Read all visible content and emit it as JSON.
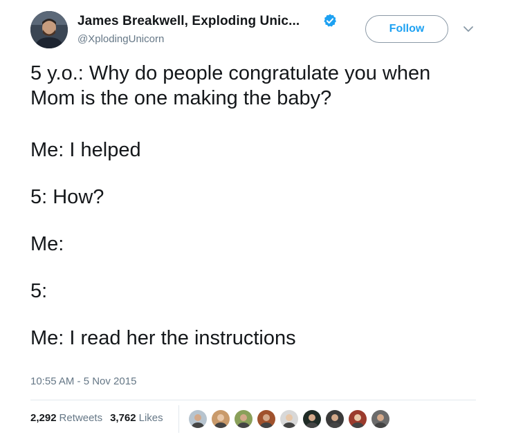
{
  "author": {
    "display_name": "James Breakwell, Exploding Unic...",
    "handle": "@XplodingUnicorn",
    "verified": true
  },
  "follow_button": {
    "label": "Follow"
  },
  "tweet": {
    "paragraphs": [
      "5 y.o.: Why do people congratulate you when\nMom is the one making the baby?",
      "Me: I helped",
      "5: How?",
      "Me:",
      "5:",
      "Me: I read her the instructions"
    ],
    "timestamp": "10:55 AM - 5 Nov 2015"
  },
  "stats": {
    "retweets_count": "2,292",
    "retweets_label": "Retweets",
    "likes_count": "3,762",
    "likes_label": "Likes"
  },
  "likers": [
    {
      "name": "liker-avatar-1",
      "color": "#b7c4cf"
    },
    {
      "name": "liker-avatar-2",
      "color": "#c99a6b"
    },
    {
      "name": "liker-avatar-3",
      "color": "#8aa05a"
    },
    {
      "name": "liker-avatar-4",
      "color": "#a0522d"
    },
    {
      "name": "liker-avatar-5",
      "color": "#d8d8d8"
    },
    {
      "name": "liker-avatar-6",
      "color": "#1f2b26"
    },
    {
      "name": "liker-avatar-7",
      "color": "#3a3a3a"
    },
    {
      "name": "liker-avatar-8",
      "color": "#9b3b2d"
    },
    {
      "name": "liker-avatar-9",
      "color": "#6b6b6b"
    }
  ],
  "colors": {
    "accent": "#1da1f2",
    "text_primary": "#14171a",
    "text_secondary": "#657786",
    "border": "#e1e8ed"
  },
  "icons": {
    "verified": "verified-badge-icon",
    "caret": "chevron-down-icon"
  }
}
